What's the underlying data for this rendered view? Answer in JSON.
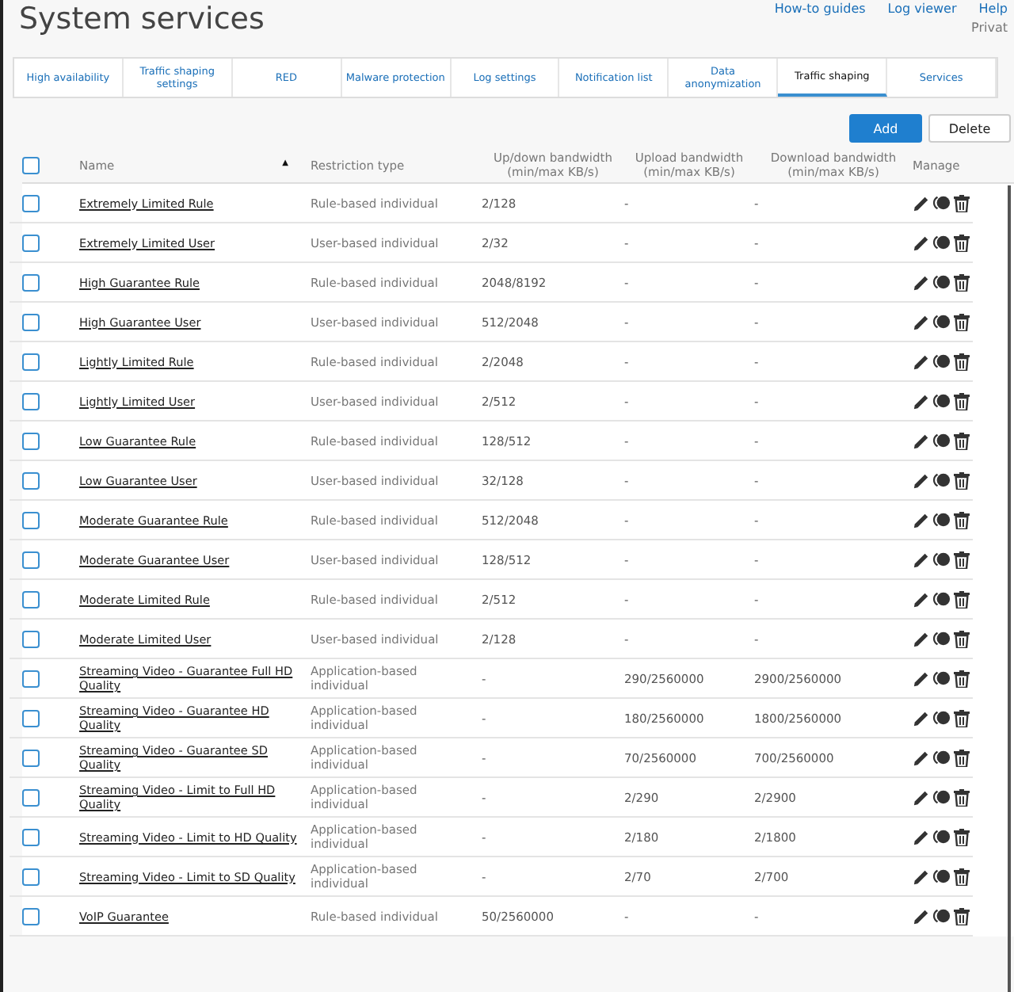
{
  "page": {
    "title": "System services",
    "links": [
      "How-to guides",
      "Log viewer",
      "Help"
    ],
    "user": "Privat"
  },
  "tabs": [
    {
      "label": "High availability",
      "selected": false
    },
    {
      "label": "Traffic shaping settings",
      "selected": false
    },
    {
      "label": "RED",
      "selected": false
    },
    {
      "label": "Malware protection",
      "selected": false
    },
    {
      "label": "Log settings",
      "selected": false
    },
    {
      "label": "Notification list",
      "selected": false
    },
    {
      "label": "Data anonymization",
      "selected": false
    },
    {
      "label": "Traffic shaping",
      "selected": true
    },
    {
      "label": "Services",
      "selected": false
    }
  ],
  "actions": {
    "add": "Add",
    "delete": "Delete"
  },
  "table": {
    "select_all": {
      "checked": false
    },
    "columns": [
      "Name",
      "Restriction type",
      "Up/down bandwidth (min/max KB/s)",
      "Upload bandwidth (min/max KB/s)",
      "Download bandwidth (min/max KB/s)",
      "Manage"
    ],
    "sort_icon": "▲",
    "rows": [
      {
        "name": "Extremely Limited Rule",
        "type": "Rule-based individual",
        "updown": "2/128",
        "upload": "-",
        "download": "-",
        "checked": false
      },
      {
        "name": "Extremely Limited User",
        "type": "User-based individual",
        "updown": "2/32",
        "upload": "-",
        "download": "-",
        "checked": false
      },
      {
        "name": "High Guarantee Rule",
        "type": "Rule-based individual",
        "updown": "2048/8192",
        "upload": "-",
        "download": "-",
        "checked": false
      },
      {
        "name": "High Guarantee User",
        "type": "User-based individual",
        "updown": "512/2048",
        "upload": "-",
        "download": "-",
        "checked": false
      },
      {
        "name": "Lightly Limited Rule",
        "type": "Rule-based individual",
        "updown": "2/2048",
        "upload": "-",
        "download": "-",
        "checked": false
      },
      {
        "name": "Lightly Limited User",
        "type": "User-based individual",
        "updown": "2/512",
        "upload": "-",
        "download": "-",
        "checked": false
      },
      {
        "name": "Low Guarantee Rule",
        "type": "Rule-based individual",
        "updown": "128/512",
        "upload": "-",
        "download": "-",
        "checked": false
      },
      {
        "name": "Low Guarantee User",
        "type": "User-based individual",
        "updown": "32/128",
        "upload": "-",
        "download": "-",
        "checked": false
      },
      {
        "name": "Moderate Guarantee Rule",
        "type": "Rule-based individual",
        "updown": "512/2048",
        "upload": "-",
        "download": "-",
        "checked": false
      },
      {
        "name": "Moderate Guarantee User",
        "type": "User-based individual",
        "updown": "128/512",
        "upload": "-",
        "download": "-",
        "checked": false
      },
      {
        "name": "Moderate Limited Rule",
        "type": "Rule-based individual",
        "updown": "2/512",
        "upload": "-",
        "download": "-",
        "checked": false
      },
      {
        "name": "Moderate Limited User",
        "type": "User-based individual",
        "updown": "2/128",
        "upload": "-",
        "download": "-",
        "checked": false
      },
      {
        "name": "Streaming Video - Guarantee Full HD Quality",
        "type": "Application-based individual",
        "updown": "-",
        "upload": "290/2560000",
        "download": "2900/2560000",
        "checked": false
      },
      {
        "name": "Streaming Video - Guarantee HD Quality",
        "type": "Application-based individual",
        "updown": "-",
        "upload": "180/2560000",
        "download": "1800/2560000",
        "checked": false
      },
      {
        "name": "Streaming Video - Guarantee SD Quality",
        "type": "Application-based individual",
        "updown": "-",
        "upload": "70/2560000",
        "download": "700/2560000",
        "checked": false
      },
      {
        "name": "Streaming Video - Limit to Full HD Quality",
        "type": "Application-based individual",
        "updown": "-",
        "upload": "2/290",
        "download": "2/2900",
        "checked": false
      },
      {
        "name": "Streaming Video - Limit to HD Quality",
        "type": "Application-based individual",
        "updown": "-",
        "upload": "2/180",
        "download": "2/1800",
        "checked": false
      },
      {
        "name": "Streaming Video - Limit to SD Quality",
        "type": "Application-based individual",
        "updown": "-",
        "upload": "2/70",
        "download": "2/700",
        "checked": false
      },
      {
        "name": "VoIP Guarantee",
        "type": "Rule-based individual",
        "updown": "50/2560000",
        "upload": "-",
        "download": "-",
        "checked": false
      }
    ]
  }
}
